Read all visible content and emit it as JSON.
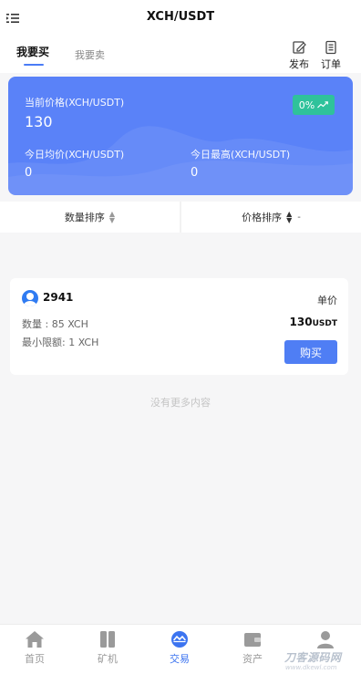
{
  "header": {
    "title": "XCH/USDT",
    "menu_icon": "menu-icon"
  },
  "tabs": {
    "buy": "我要买",
    "sell": "我要卖",
    "active": "buy"
  },
  "actions": {
    "publish": "发布",
    "orders": "订单"
  },
  "price_card": {
    "current_label": "当前价格(XCH/USDT)",
    "current_value": "130",
    "change": "0%",
    "avg_label": "今日均价(XCH/USDT)",
    "avg_value": "0",
    "high_label": "今日最高(XCH/USDT)",
    "high_value": "0",
    "bg_color": "#5a82f8",
    "badge_color": "#2fc29b"
  },
  "sort": {
    "quantity": "数量排序",
    "price": "价格排序",
    "price_extra": "-"
  },
  "listing": {
    "seller": "2941",
    "unit_label": "单价",
    "quantity": "数量 : 85 XCH",
    "min_limit": "最小限额: 1 XCH",
    "price": "130",
    "price_unit": "USDT",
    "buy_label": "购买"
  },
  "no_more": "没有更多内容",
  "bottom_nav": {
    "home": "首页",
    "mining": "矿机",
    "trade": "交易",
    "assets": "资产",
    "active": "trade",
    "active_color": "#3c74f0"
  },
  "watermark": {
    "text": "刀客源码网",
    "sub": "www.dkewl.com"
  }
}
